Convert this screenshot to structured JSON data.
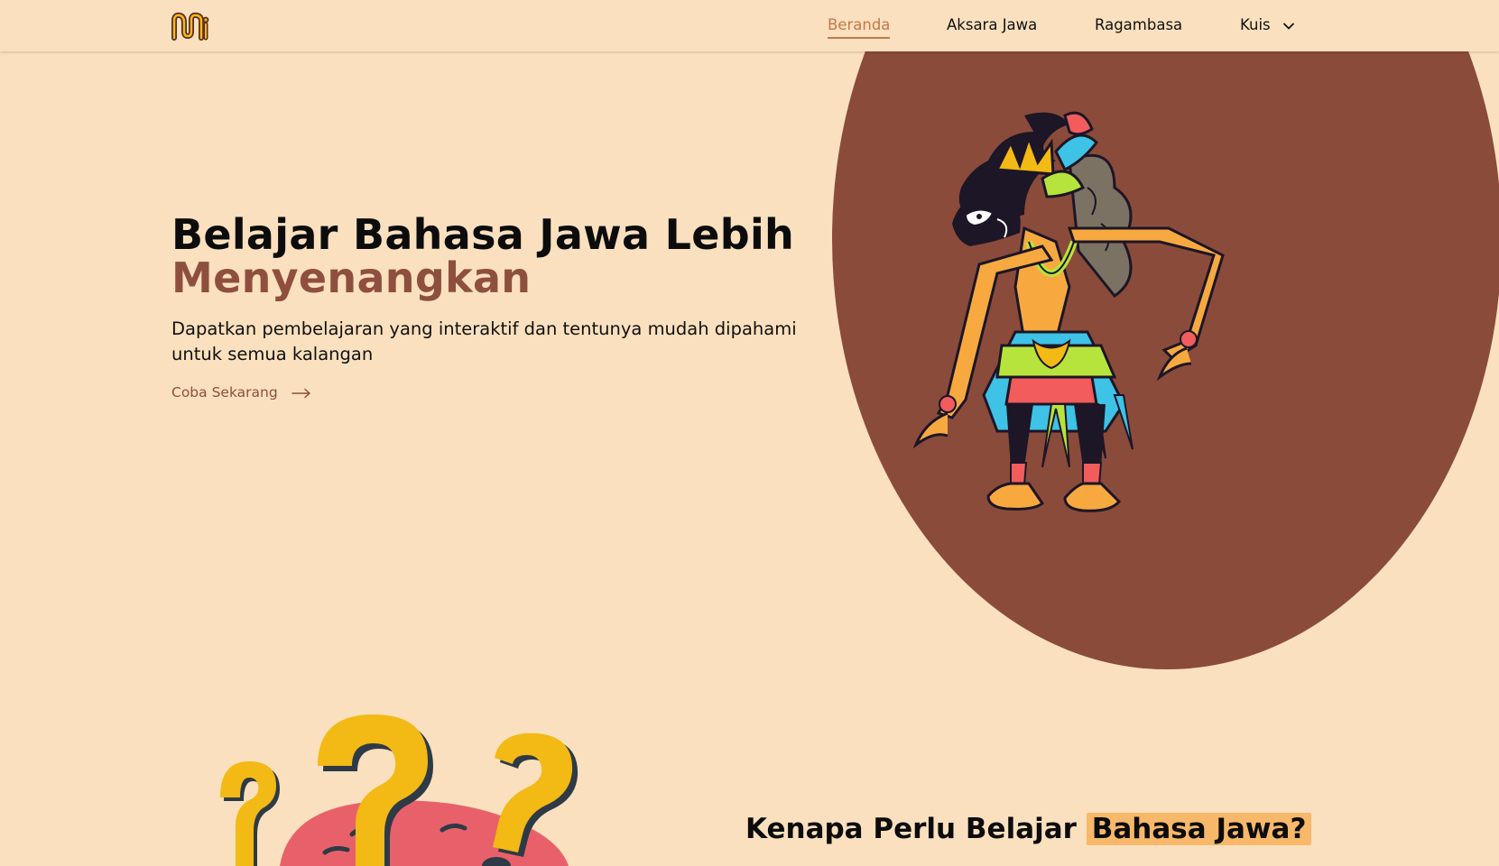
{
  "nav": {
    "items": [
      {
        "label": "Beranda",
        "active": true
      },
      {
        "label": "Aksara Jawa",
        "active": false
      },
      {
        "label": "Ragambasa",
        "active": false
      },
      {
        "label": "Kuis",
        "active": false,
        "has_dropdown": true
      }
    ]
  },
  "hero": {
    "title_line1": "Belajar Bahasa Jawa Lebih",
    "title_line2": "Menyenangkan",
    "subtitle": "Dapatkan pembelajaran yang interaktif dan tentunya mudah dipahami untuk semua kalangan",
    "cta_label": "Coba Sekarang",
    "illustration": "wayang-puppet-illustration"
  },
  "section": {
    "title_prefix": "Kenapa Perlu Belajar",
    "title_highlight": "Bahasa Jawa?",
    "illustration": "question-marks-illustration"
  },
  "colors": {
    "background": "#fae0be",
    "accent_brown": "#8e4f3e",
    "circle_brown": "#8b4b3a",
    "nav_active": "#c3794b",
    "highlight": "#f7b86a",
    "question_yellow": "#f3b914",
    "blob_pink": "#e8616a"
  },
  "icons": {
    "logo": "app-logo",
    "kuis_dropdown": "chevron-down-icon",
    "cta_arrow": "arrow-right-icon"
  }
}
